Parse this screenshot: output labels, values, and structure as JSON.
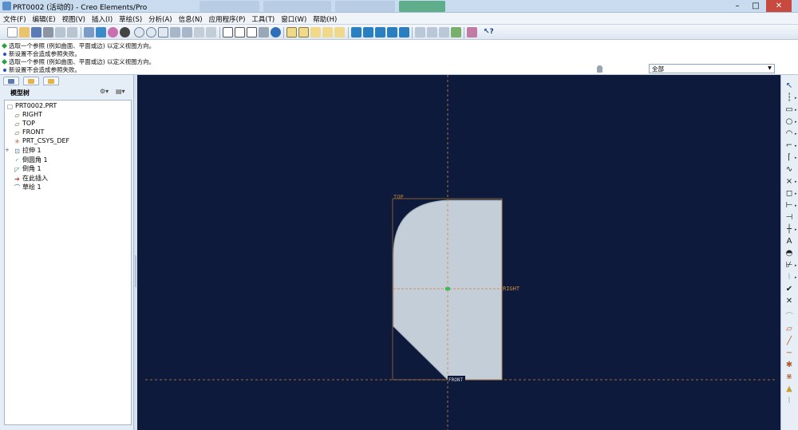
{
  "window": {
    "title": "PRT0002 (活动的) - Creo Elements/Pro"
  },
  "menu": [
    "文件(F)",
    "编辑(E)",
    "视图(V)",
    "插入(I)",
    "草绘(S)",
    "分析(A)",
    "信息(N)",
    "应用程序(P)",
    "工具(T)",
    "窗口(W)",
    "帮助(H)"
  ],
  "messages": [
    {
      "type": "prompt",
      "text": "选取一个参照 (例如曲面、平面或边) 以定义视图方向。"
    },
    {
      "type": "info",
      "text": "新设置不会造成参照失败。"
    },
    {
      "type": "prompt",
      "text": "选取一个参照 (例如曲面、平面或边) 以定义视图方向。"
    },
    {
      "type": "info",
      "text": "新设置不会造成参照失败。"
    }
  ],
  "filter": {
    "selected": "全部"
  },
  "model_tree": {
    "header": "模型树",
    "items": [
      {
        "label": "PRT0002.PRT",
        "icon": "part-icon",
        "indent": 0
      },
      {
        "label": "RIGHT",
        "icon": "datum-plane-icon",
        "indent": 1
      },
      {
        "label": "TOP",
        "icon": "datum-plane-icon",
        "indent": 1
      },
      {
        "label": "FRONT",
        "icon": "datum-plane-icon",
        "indent": 1
      },
      {
        "label": "PRT_CSYS_DEF",
        "icon": "csys-icon",
        "indent": 1
      },
      {
        "label": "拉伸 1",
        "icon": "extrude-icon",
        "indent": 1,
        "expandable": true
      },
      {
        "label": "倒圆角 1",
        "icon": "round-icon",
        "indent": 1
      },
      {
        "label": "倒角 1",
        "icon": "chamfer-icon",
        "indent": 1
      },
      {
        "label": "在此插入",
        "icon": "insert-here-icon",
        "indent": 1
      },
      {
        "label": "草绘 1",
        "icon": "sketch-icon",
        "indent": 1
      }
    ]
  },
  "canvas": {
    "datum_labels": {
      "top": "TOP",
      "right": "RIGHT",
      "front": "FRONT"
    },
    "background": "#0e1a3b",
    "part_fill": "#c4ced8",
    "datum_color": "#c98a3b"
  },
  "right_toolbar": [
    "select-icon",
    "centerline-icon",
    "rectangle-icon",
    "circle-icon",
    "arc-icon",
    "fillet-icon",
    "spline-icon",
    "point-icon",
    "offset-icon",
    "dimension-icon",
    "modify-icon",
    "constraint-icon",
    "text-icon",
    "palette-icon",
    "trim-icon",
    "mirror-icon",
    "accept-icon",
    "cancel-icon"
  ]
}
